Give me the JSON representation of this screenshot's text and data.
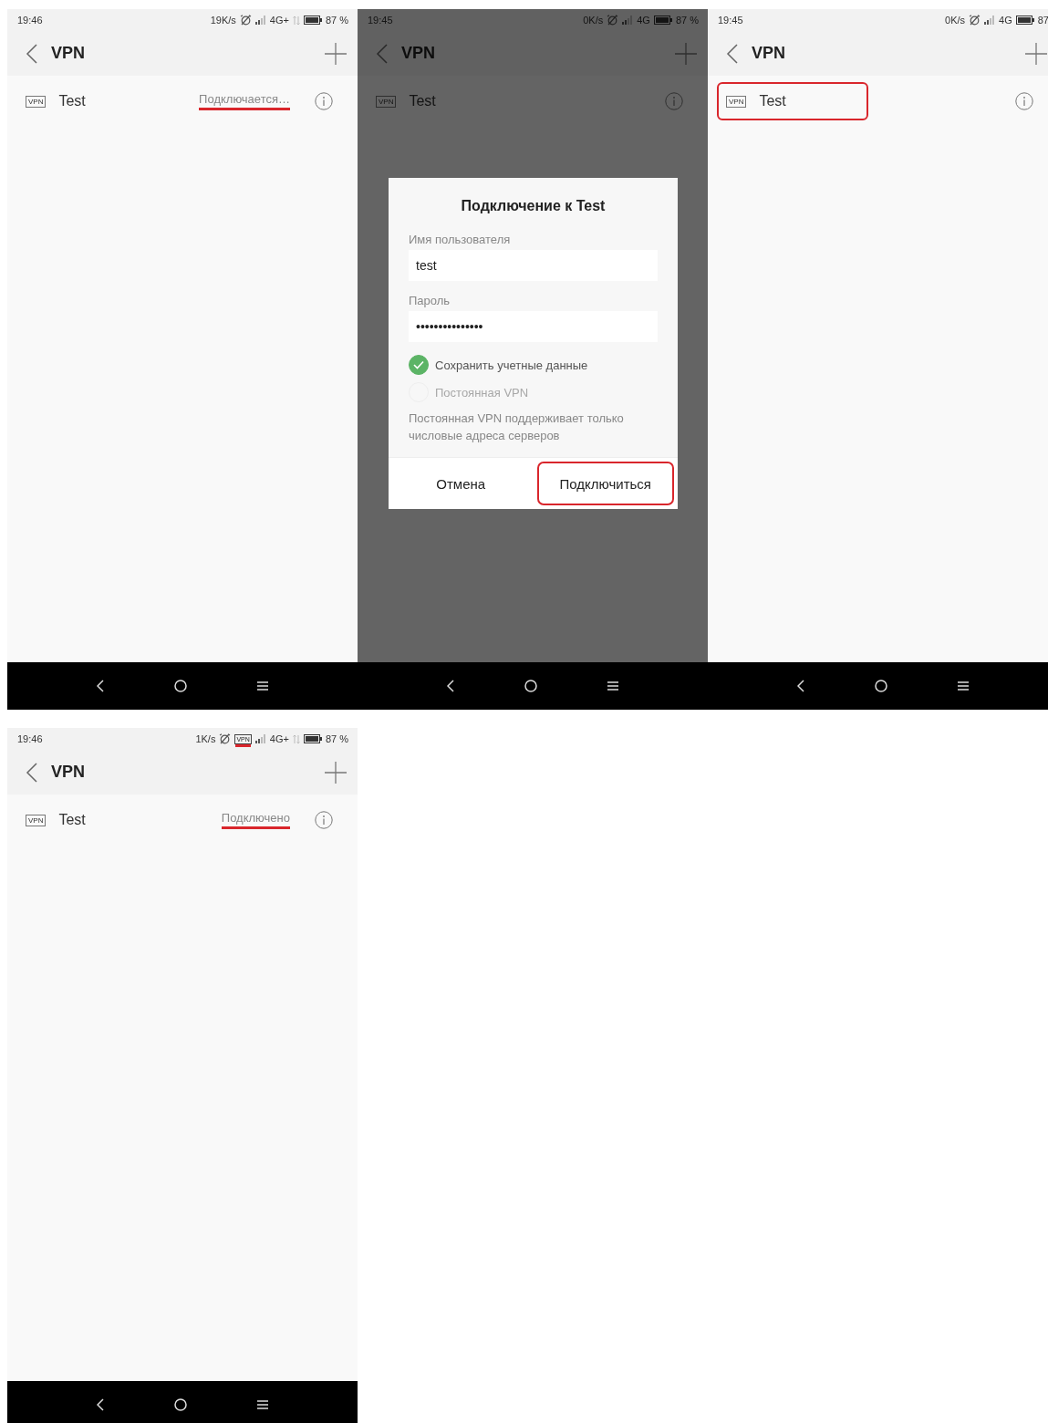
{
  "screens": [
    {
      "status_bar": {
        "time": "19:46",
        "speed": "19K/s",
        "network": "4G+",
        "data_activity": true,
        "battery": "87 %"
      },
      "header": {
        "title": "VPN"
      },
      "vpn_list": [
        {
          "icon_label": "VPN",
          "name": "Test",
          "status": "Подключается…",
          "status_highlighted": true,
          "highlighted": false
        }
      ]
    },
    {
      "status_bar": {
        "time": "19:45",
        "speed": "0K/s",
        "network": "4G",
        "data_activity": false,
        "battery": "87 %"
      },
      "header": {
        "title": "VPN"
      },
      "vpn_list": [
        {
          "icon_label": "VPN",
          "name": "Test",
          "highlighted": false
        }
      ],
      "dialog": {
        "title": "Подключение к Test",
        "fields": [
          {
            "label": "Имя пользователя",
            "value": "test"
          },
          {
            "label": "Пароль",
            "value": "•••••••••••••••"
          }
        ],
        "options": [
          {
            "label": "Сохранить учетные данные",
            "checked": true,
            "disabled": false
          },
          {
            "label": "Постоянная VPN",
            "checked": false,
            "disabled": true
          }
        ],
        "note": "Постоянная VPN поддерживает только числовые адреса серверов",
        "buttons": [
          {
            "label": "Отмена",
            "highlighted": false
          },
          {
            "label": "Подключиться",
            "highlighted": true
          }
        ]
      }
    },
    {
      "status_bar": {
        "time": "19:45",
        "speed": "0K/s",
        "network": "4G",
        "data_activity": false,
        "battery": "87"
      },
      "header": {
        "title": "VPN"
      },
      "vpn_list": [
        {
          "icon_label": "VPN",
          "name": "Test",
          "highlighted": true
        }
      ]
    },
    {
      "status_bar": {
        "time": "19:46",
        "speed": "1K/s",
        "vpn_indicator": {
          "label": "VPN",
          "highlighted": true
        },
        "network": "4G+",
        "data_activity": true,
        "battery": "87 %"
      },
      "header": {
        "title": "VPN"
      },
      "vpn_list": [
        {
          "icon_label": "VPN",
          "name": "Test",
          "status": "Подключено",
          "status_highlighted": true,
          "highlighted": false
        }
      ]
    }
  ]
}
